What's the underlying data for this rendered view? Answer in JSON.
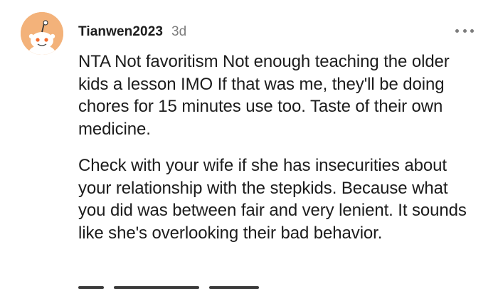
{
  "comment": {
    "username": "Tianwen2023",
    "timestamp": "3d",
    "avatar_icon": "snoo-avatar-icon",
    "avatar_color": "#f3b27a",
    "more_icon": "more-options-icon",
    "paragraphs": [
      "NTA Not favoritism Not enough teaching the older kids a lesson IMO If that was me, they'll be doing chores for 15 minutes use too. Taste of their own medicine.",
      "Check with your wife if she has insecurities about your relationship with the stepkids. Because what you did was between fair and very lenient. It sounds like she's overlooking their bad behavior."
    ]
  }
}
